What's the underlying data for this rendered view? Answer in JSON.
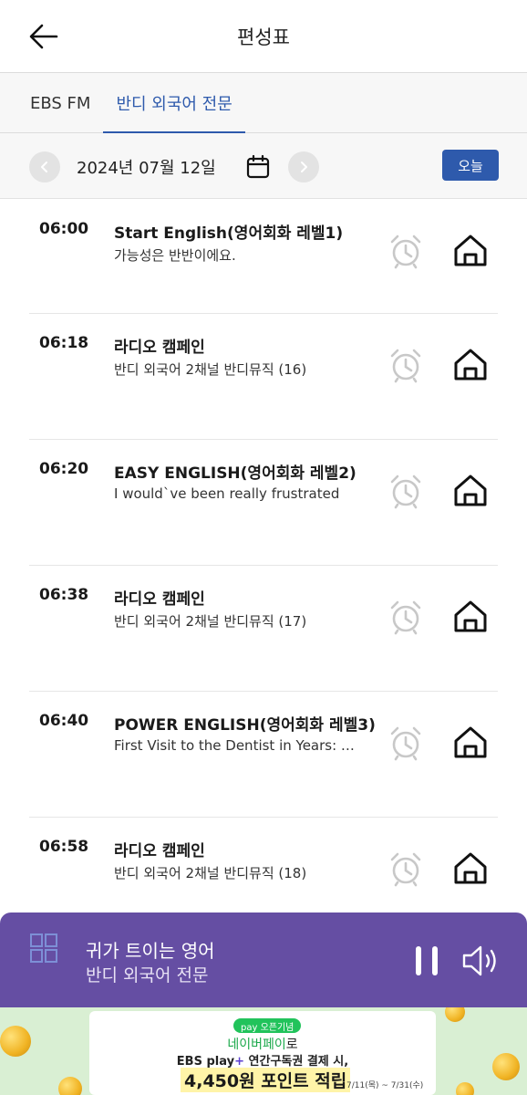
{
  "header": {
    "title": "편성표"
  },
  "tabs": [
    {
      "label": "EBS FM",
      "active": false
    },
    {
      "label": "반디 외국어 전문",
      "active": true
    }
  ],
  "date_bar": {
    "date": "2024년 07월 12일",
    "today_label": "오늘"
  },
  "programs": [
    {
      "time": "06:00",
      "title": "Start English(영어회화 레벨1)",
      "subtitle": "가능성은 반반이에요."
    },
    {
      "time": "06:18",
      "title": "라디오 캠페인",
      "subtitle": "반디 외국어 2채널 반디뮤직 (16)"
    },
    {
      "time": "06:20",
      "title": "EASY ENGLISH(영어회화 레벨2)",
      "subtitle": "I would`ve been really frustrated"
    },
    {
      "time": "06:38",
      "title": "라디오 캠페인",
      "subtitle": "반디 외국어 2채널 반디뮤직 (17)"
    },
    {
      "time": "06:40",
      "title": "POWER ENGLISH(영어회화 레벨3)",
      "subtitle": "First Visit to the Dentist in Years: M..."
    },
    {
      "time": "06:58",
      "title": "라디오 캠페인",
      "subtitle": "반디 외국어 2채널 반디뮤직 (18)"
    }
  ],
  "player": {
    "title": "귀가 트이는 영어",
    "channel": "반디 외국어 전문"
  },
  "banner": {
    "badge": "pay 오픈기념",
    "line1_highlight": "네이버페이",
    "line1_rest": "로",
    "line2_brand": "EBS play",
    "line2_plus": "+",
    "line2_rest": " 연간구독권 결제 시,",
    "line3": "4,450원 포인트 적립",
    "period": "7/11(목) ~ 7/31(수)"
  },
  "colors": {
    "accent": "#2e5aac",
    "player_bg": "#654ea3",
    "banner_bg": "#d9efd3"
  },
  "icons": {
    "back": "arrow-left-icon",
    "calendar": "calendar-icon",
    "alarm": "alarm-clock-icon",
    "home": "home-icon",
    "pause": "pause-icon",
    "volume": "volume-icon"
  }
}
